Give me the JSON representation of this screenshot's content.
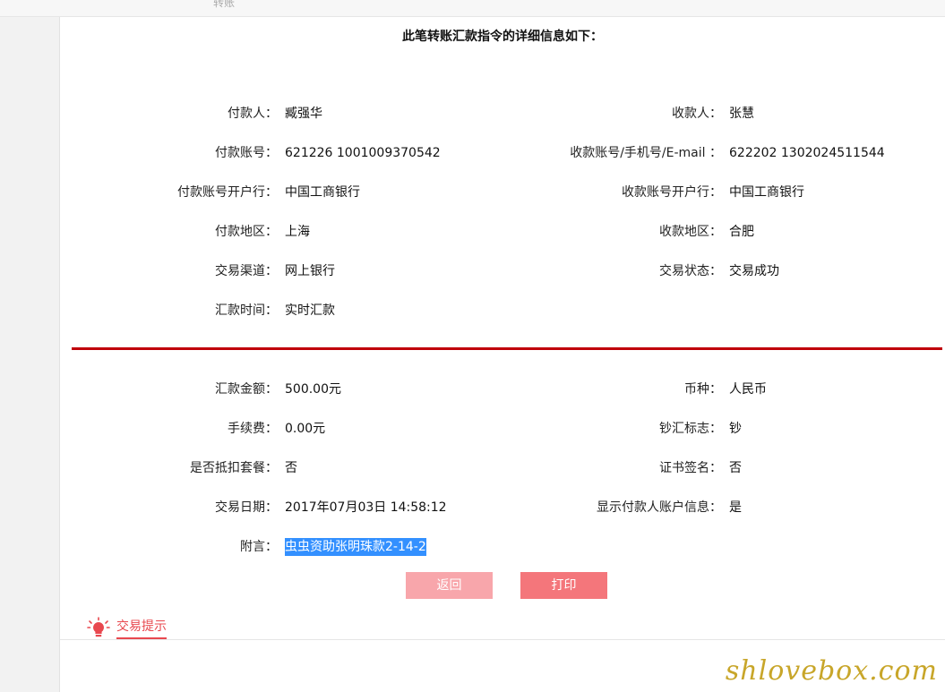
{
  "topbar": {
    "crumb": "转账"
  },
  "heading": "此笔转账汇款指令的详细信息如下：",
  "left_rows": [
    {
      "label": "付款人：",
      "value": "臧强华"
    },
    {
      "label": "付款账号：",
      "value": "621226 1001009370542"
    },
    {
      "label": "付款账号开户行：",
      "value": "中国工商银行"
    },
    {
      "label": "付款地区：",
      "value": "上海"
    },
    {
      "label": "交易渠道：",
      "value": "网上银行"
    },
    {
      "label": "汇款时间：",
      "value": "实时汇款"
    }
  ],
  "right_rows": [
    {
      "label": "收款人：",
      "value": "张慧"
    },
    {
      "label": "收款账号/手机号/E-mail ：",
      "value": "622202 1302024511544"
    },
    {
      "label": "收款账号开户行：",
      "value": "中国工商银行"
    },
    {
      "label": "收款地区：",
      "value": "合肥"
    },
    {
      "label": "交易状态：",
      "value": "交易成功"
    }
  ],
  "left_rows_2": [
    {
      "label": "汇款金额：",
      "value": "500.00元"
    },
    {
      "label": "手续费：",
      "value": "0.00元"
    },
    {
      "label": "是否抵扣套餐：",
      "value": "否"
    },
    {
      "label": "交易日期：",
      "value": "2017年07月03日 14:58:12"
    },
    {
      "label": "附言：",
      "value": "虫虫资助张明珠款2-14-2"
    }
  ],
  "right_rows_2": [
    {
      "label": "币种：",
      "value": "人民币"
    },
    {
      "label": "钞汇标志：",
      "value": "钞"
    },
    {
      "label": "证书签名：",
      "value": "否"
    },
    {
      "label": "显示付款人账户信息：",
      "value": "是"
    }
  ],
  "buttons": {
    "back": "返回",
    "print": "打印"
  },
  "tips": {
    "label": "交易提示",
    "icon": "lightbulb-icon"
  },
  "watermark": "shlovebox.com",
  "colors": {
    "divider": "#c0000a",
    "accent": "#f4767b",
    "selection": "#3390ff"
  }
}
